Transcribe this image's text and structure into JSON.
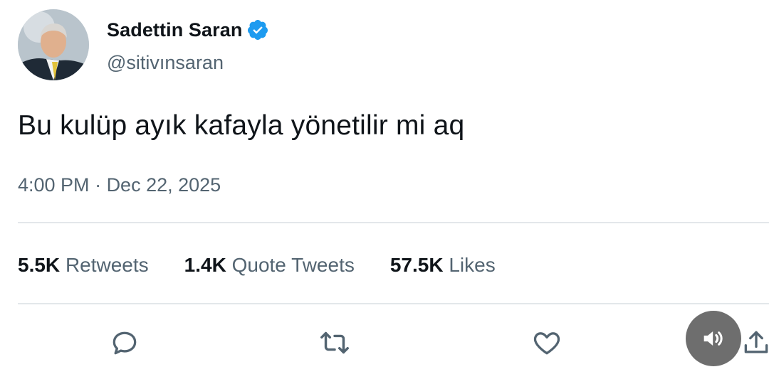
{
  "author": {
    "display_name": "Sadettin Saran",
    "handle": "@sitivınsaran",
    "verified": true,
    "verified_color": "#1d9bf0"
  },
  "tweet": {
    "text": "Bu kulüp ayık kafayla yönetilir mi aq",
    "time": "4:00 PM",
    "separator": " · ",
    "date": "Dec 22, 2025"
  },
  "stats": [
    {
      "count": "5.5K",
      "label": "Retweets"
    },
    {
      "count": "1.4K",
      "label": "Quote Tweets"
    },
    {
      "count": "57.5K",
      "label": "Likes"
    }
  ],
  "actions": {
    "reply_icon": "reply-icon",
    "retweet_icon": "retweet-icon",
    "like_icon": "heart-icon",
    "share_icon": "share-icon"
  },
  "overlay": {
    "sound_icon": "speaker-icon"
  },
  "colors": {
    "text_primary": "#0f1419",
    "text_secondary": "#536471",
    "accent": "#1d9bf0",
    "divider": "#e3e7ea"
  }
}
